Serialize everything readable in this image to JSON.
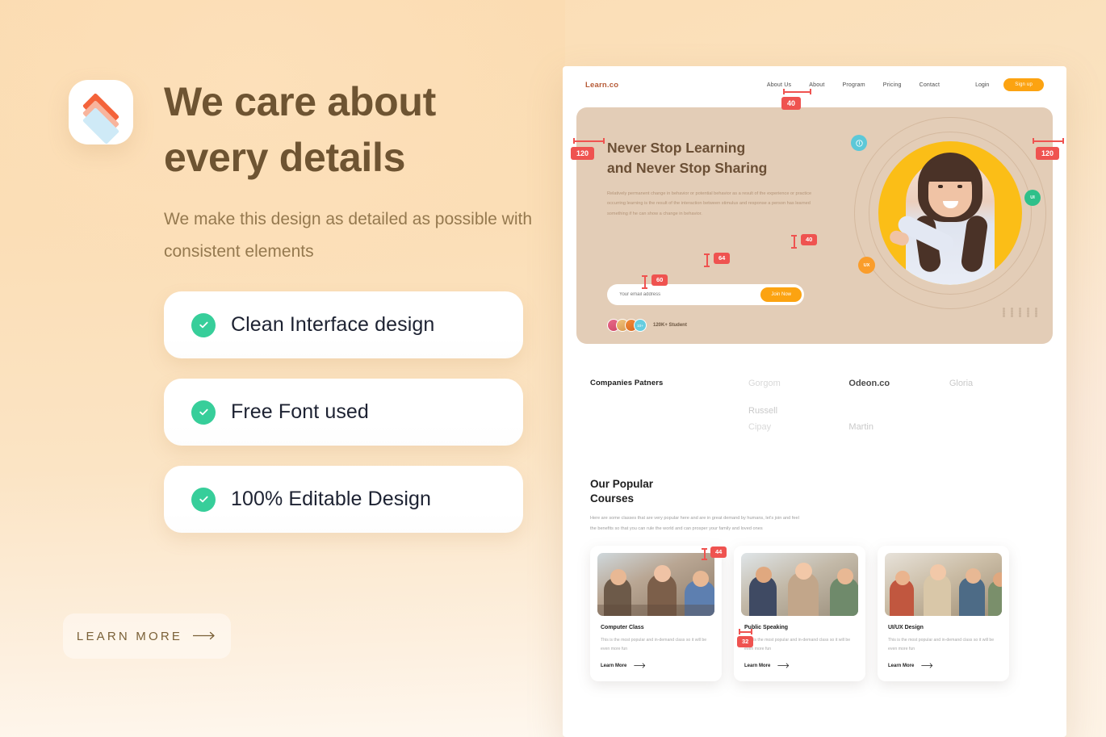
{
  "promo": {
    "logo_icon": "layers-icon",
    "headline": "We care about every details",
    "subhead": "We make this design as detailed as possible with consistent elements",
    "features": [
      {
        "label": "Clean Interface design",
        "icon": "check-circle-icon"
      },
      {
        "label": "Free Font used",
        "icon": "check-circle-icon"
      },
      {
        "label": "100% Editable Design",
        "icon": "check-circle-icon"
      }
    ],
    "learn_more": {
      "label": "LEARN MORE",
      "icon": "arrow-right-icon"
    }
  },
  "site": {
    "brand": "Learn.co",
    "nav_links": [
      "About Us",
      "About",
      "Program",
      "Pricing",
      "Contact"
    ],
    "login_label": "Login",
    "signup_label": "Sign up",
    "hero": {
      "title_line1": "Never Stop Learning",
      "title_line2": "and Never Stop Sharing",
      "body": "Relatively permanent change in behavior or potential behavior as a result of the experience or practice occurring learning is the result of the interaction between stimulus and response a person has learned something if he can show a change in behavior.",
      "email_placeholder": "Your email address",
      "join_label": "Join Now",
      "avatar_more": "10+",
      "students": "120K+ Student",
      "badges": [
        "UI",
        "UX"
      ]
    },
    "partners": {
      "title": "Companies Patners",
      "names": [
        "Gorgom",
        "Odeon.co",
        "Gloria",
        "Russell",
        "Cipay",
        "Martin"
      ]
    },
    "courses": {
      "title_line1": "Our Popular",
      "title_line2": "Courses",
      "body": "Here are some classes that are very popular here and are in great demand by humans, let's join and feel the benefits so that you can rule the world and can prosper your family and loved ones",
      "cards": [
        {
          "name": "Computer Class",
          "desc": "This is the most popular and in-demand class so it will be even more fun",
          "link": "Learn More"
        },
        {
          "name": "Public Speaking",
          "desc": "This is the most popular and in-demand class so it will be even more fun",
          "link": "Learn More"
        },
        {
          "name": "UI/UX Design",
          "desc": "This is the most popular and in-demand class so it will be even more fun",
          "link": "Learn More"
        }
      ]
    }
  },
  "measurements": {
    "top_gap": "40",
    "left_margin": "120",
    "right_margin": "120",
    "hero_text_gap": "40",
    "input_height": "64",
    "students_gap": "60",
    "card_gap": "44",
    "card_inner": "32"
  },
  "colors": {
    "accent_orange": "#fca311",
    "brand_red": "#b65b37",
    "measure_red": "#ef5350",
    "check_green": "#37ce9a",
    "hero_yellow": "#fbbe17",
    "heading_brown": "#6e5432",
    "hero_panel": "#e3cdb7"
  }
}
